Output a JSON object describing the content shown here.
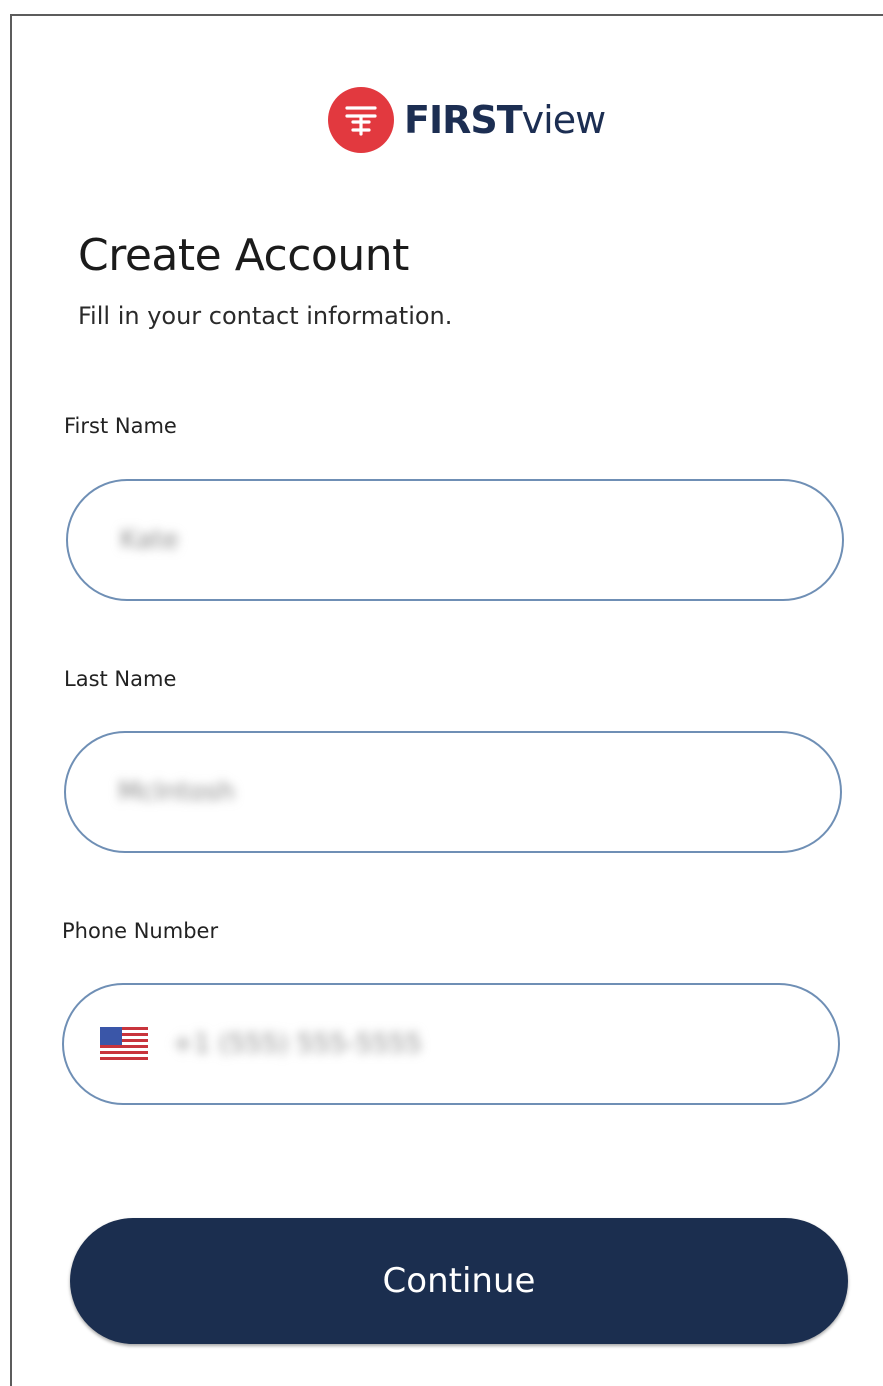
{
  "brand": {
    "name_bold": "FIRST",
    "name_light": "view",
    "mark_color": "#e2393f",
    "text_color": "#1c2e52"
  },
  "header": {
    "title": "Create Account",
    "subtitle": "Fill in your contact information."
  },
  "form": {
    "first_name": {
      "label": "First Name",
      "value": "Kate"
    },
    "last_name": {
      "label": "Last Name",
      "value": "McIntosh"
    },
    "phone": {
      "label": "Phone Number",
      "country_icon": "us-flag-icon",
      "value": "+1 (555) 555-5555"
    }
  },
  "actions": {
    "continue_label": "Continue",
    "continue_color": "#1b2e4f"
  }
}
